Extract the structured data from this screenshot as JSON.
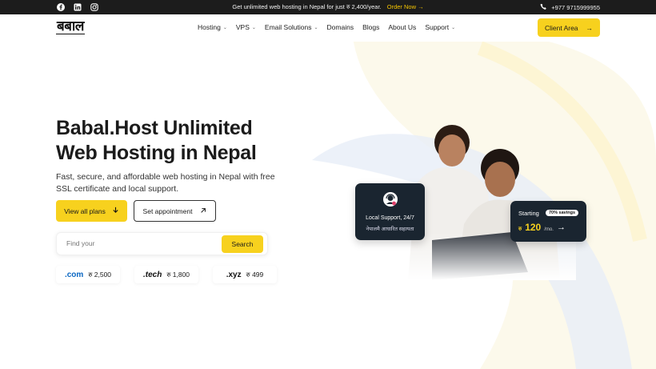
{
  "topbar": {
    "promo_text": "Get unlimited web hosting in Nepal for just रु 2,400/year.",
    "order_label": "Order Now",
    "phone": "+977 9715999955",
    "social_icons": [
      "facebook-icon",
      "linkedin-icon",
      "instagram-icon"
    ]
  },
  "header": {
    "logo_text": "बबाल",
    "nav": [
      {
        "label": "Hosting",
        "dropdown": true
      },
      {
        "label": "VPS",
        "dropdown": true
      },
      {
        "label": "Email Solutions",
        "dropdown": true
      },
      {
        "label": "Domains",
        "dropdown": false
      },
      {
        "label": "Blogs",
        "dropdown": false
      },
      {
        "label": "About Us",
        "dropdown": false
      },
      {
        "label": "Support",
        "dropdown": true
      }
    ],
    "client_area_label": "Client Area"
  },
  "hero": {
    "title_line1": "Babal.Host Unlimited",
    "title_line2": "Web Hosting in Nepal",
    "subtitle": "Fast, secure, and affordable web hosting in Nepal with free SSL certificate and local support.",
    "plans_button": "View all plans",
    "appointment_button": "Set appointment",
    "search_placeholder": "Find your",
    "search_button": "Search"
  },
  "domains": [
    {
      "tld": ".com",
      "price": "रु 2,500"
    },
    {
      "tld": ".tech",
      "price": "रु 1,800"
    },
    {
      "tld": ".xyz",
      "price": "रु 499"
    }
  ],
  "support_card": {
    "title": "Local Support, 24/7",
    "subtitle": "नेपालमै आधारित सहायता"
  },
  "price_card": {
    "starting_label": "Starting",
    "badge": "70% savings",
    "currency": "रु",
    "amount": "120",
    "period": "/mo."
  },
  "colors": {
    "accent": "#f7d11e",
    "dark": "#1c1c1c",
    "card_bg": "#1a2530"
  }
}
